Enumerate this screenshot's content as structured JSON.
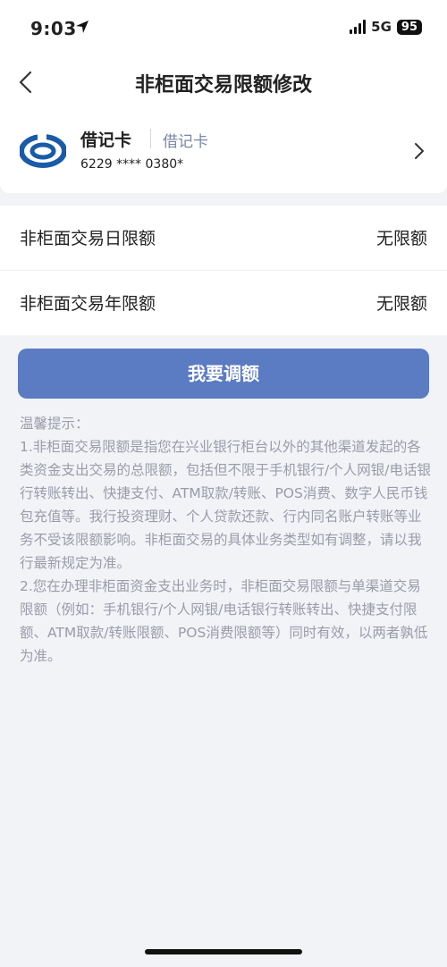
{
  "status_bar": {
    "time": "9:03",
    "network": "5G",
    "battery": "95"
  },
  "nav": {
    "title": "非柜面交易限额修改"
  },
  "card": {
    "name": "借记卡",
    "type": "借记卡",
    "number": "6229 **** 0380*"
  },
  "limits": [
    {
      "label": "非柜面交易日限额",
      "value": "无限额"
    },
    {
      "label": "非柜面交易年限额",
      "value": "无限额"
    }
  ],
  "adjust_button": {
    "label": "我要调额"
  },
  "tips": {
    "heading": "温馨提示：",
    "items": [
      "1.非柜面交易限额是指您在兴业银行柜台以外的其他渠道发起的各类资金支出交易的总限额，包括但不限于手机银行/个人网银/电话银行转账转出、快捷支付、ATM取款/转账、POS消费、数字人民币钱包充值等。我行投资理财、个人贷款还款、行内同名账户转账等业务不受该限额影响。非柜面交易的具体业务类型如有调整，请以我行最新规定为准。",
      "2.您在办理非柜面资金支出业务时，非柜面交易限额与单渠道交易限额（例如：手机银行/个人网银/电话银行转账转出、快捷支付限额、ATM取款/转账限额、POS消费限额等）同时有效，以两者孰低为准。"
    ]
  },
  "colors": {
    "accent": "#5b7bc2",
    "logo_blue": "#1a5ba8",
    "tips_text": "#9a9ca8"
  },
  "icons": [
    "location-arrow-icon",
    "signal-icon",
    "back-chevron-icon",
    "bank-logo-icon",
    "chevron-right-icon"
  ]
}
